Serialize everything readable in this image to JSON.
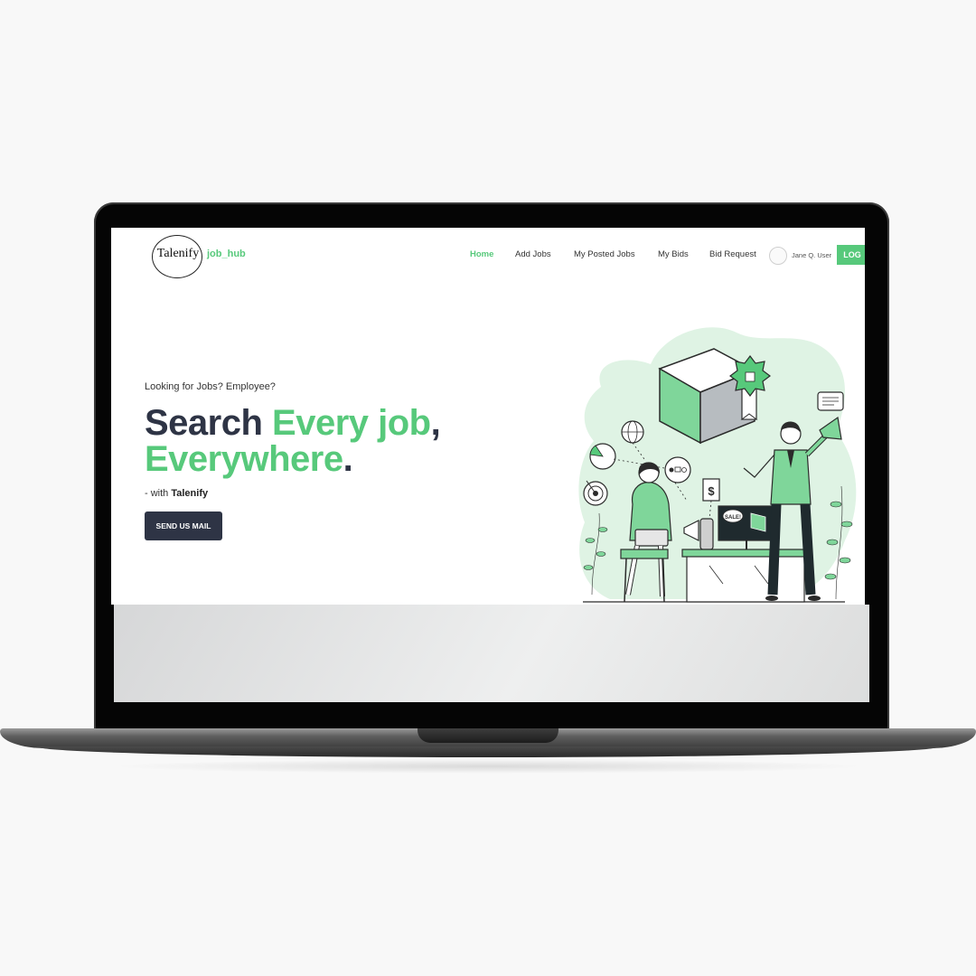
{
  "brand": {
    "logo_text": "Talenify",
    "suffix": "job_hub"
  },
  "nav": {
    "items": [
      {
        "label": "Home",
        "active": true
      },
      {
        "label": "Add Jobs",
        "active": false
      },
      {
        "label": "My Posted Jobs",
        "active": false
      },
      {
        "label": "My Bids",
        "active": false
      },
      {
        "label": "Bid Request",
        "active": false
      }
    ],
    "user_name": "Jane Q. User",
    "login_label": "LOG"
  },
  "hero": {
    "subtitle": "Looking for Jobs? Employee?",
    "title_part1": "Search ",
    "title_part2": "Every job",
    "title_part3": ",",
    "title_part4": "Everywhere",
    "title_part5": ".",
    "with_prefix": "- with ",
    "with_brand": "Talenify",
    "button_label": "SEND US MAIL"
  },
  "illustration": {
    "sale_tag": "SALE!",
    "price_symbol": "$"
  },
  "colors": {
    "accent": "#57c97b",
    "dark": "#2e3445",
    "blob": "#dff3e4"
  }
}
